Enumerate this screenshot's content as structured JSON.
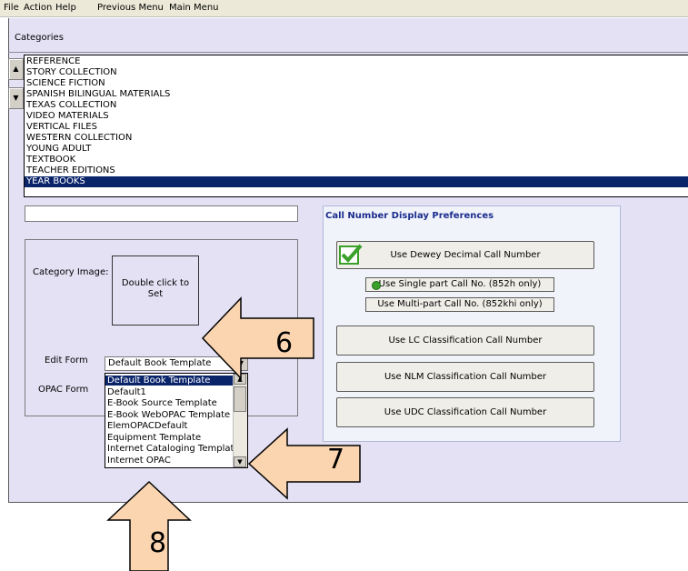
{
  "menu": {
    "file": "File",
    "action": "Action",
    "help": "Help",
    "previous_menu": "Previous Menu",
    "main_menu": "Main Menu"
  },
  "categories": {
    "label": "Categories",
    "items": [
      "REFERENCE",
      "STORY COLLECTION",
      "SCIENCE FICTION",
      "SPANISH BILINGUAL MATERIALS",
      "TEXAS COLLECTION",
      "VIDEO MATERIALS",
      "VERTICAL FILES",
      "WESTERN COLLECTION",
      "YOUNG ADULT",
      "TEXTBOOK",
      "TEACHER EDITIONS",
      "YEAR BOOKS"
    ],
    "selected": "YEAR BOOKS"
  },
  "description_input": {
    "value": ""
  },
  "category_image": {
    "label": "Category Image:",
    "placeholder_line1": "Double click to",
    "placeholder_line2": "Set"
  },
  "edit_form": {
    "label": "Edit Form",
    "value": "Default Book Template"
  },
  "opac_form": {
    "label": "OPAC Form"
  },
  "dropdown": {
    "options": [
      "Default Book Template",
      "Default1",
      "E-Book Source Template",
      "E-Book WebOPAC Template",
      "ElemOPACDefault",
      "Equipment Template",
      "Internet Cataloging Template",
      "Internet OPAC"
    ],
    "selected": "Default Book Template"
  },
  "call_number_prefs": {
    "title": "Call Number Display Preferences",
    "dewey": "Use Dewey Decimal Call Number",
    "single_part": "Use Single part Call No. (852h only)",
    "multi_part": "Use Multi-part Call No. (852khi only)",
    "lc": "Use LC Classification Call Number",
    "nlm": "Use NLM Classification Call Number",
    "udc": "Use UDC Classification Call Number"
  },
  "callouts": {
    "six": "6",
    "seven": "7",
    "eight": "8"
  },
  "colors": {
    "selection": "#0a246a",
    "panel_bg": "#e4e1f4",
    "callout_fill": "#fbd5b0",
    "check_green": "#3aa02a"
  }
}
